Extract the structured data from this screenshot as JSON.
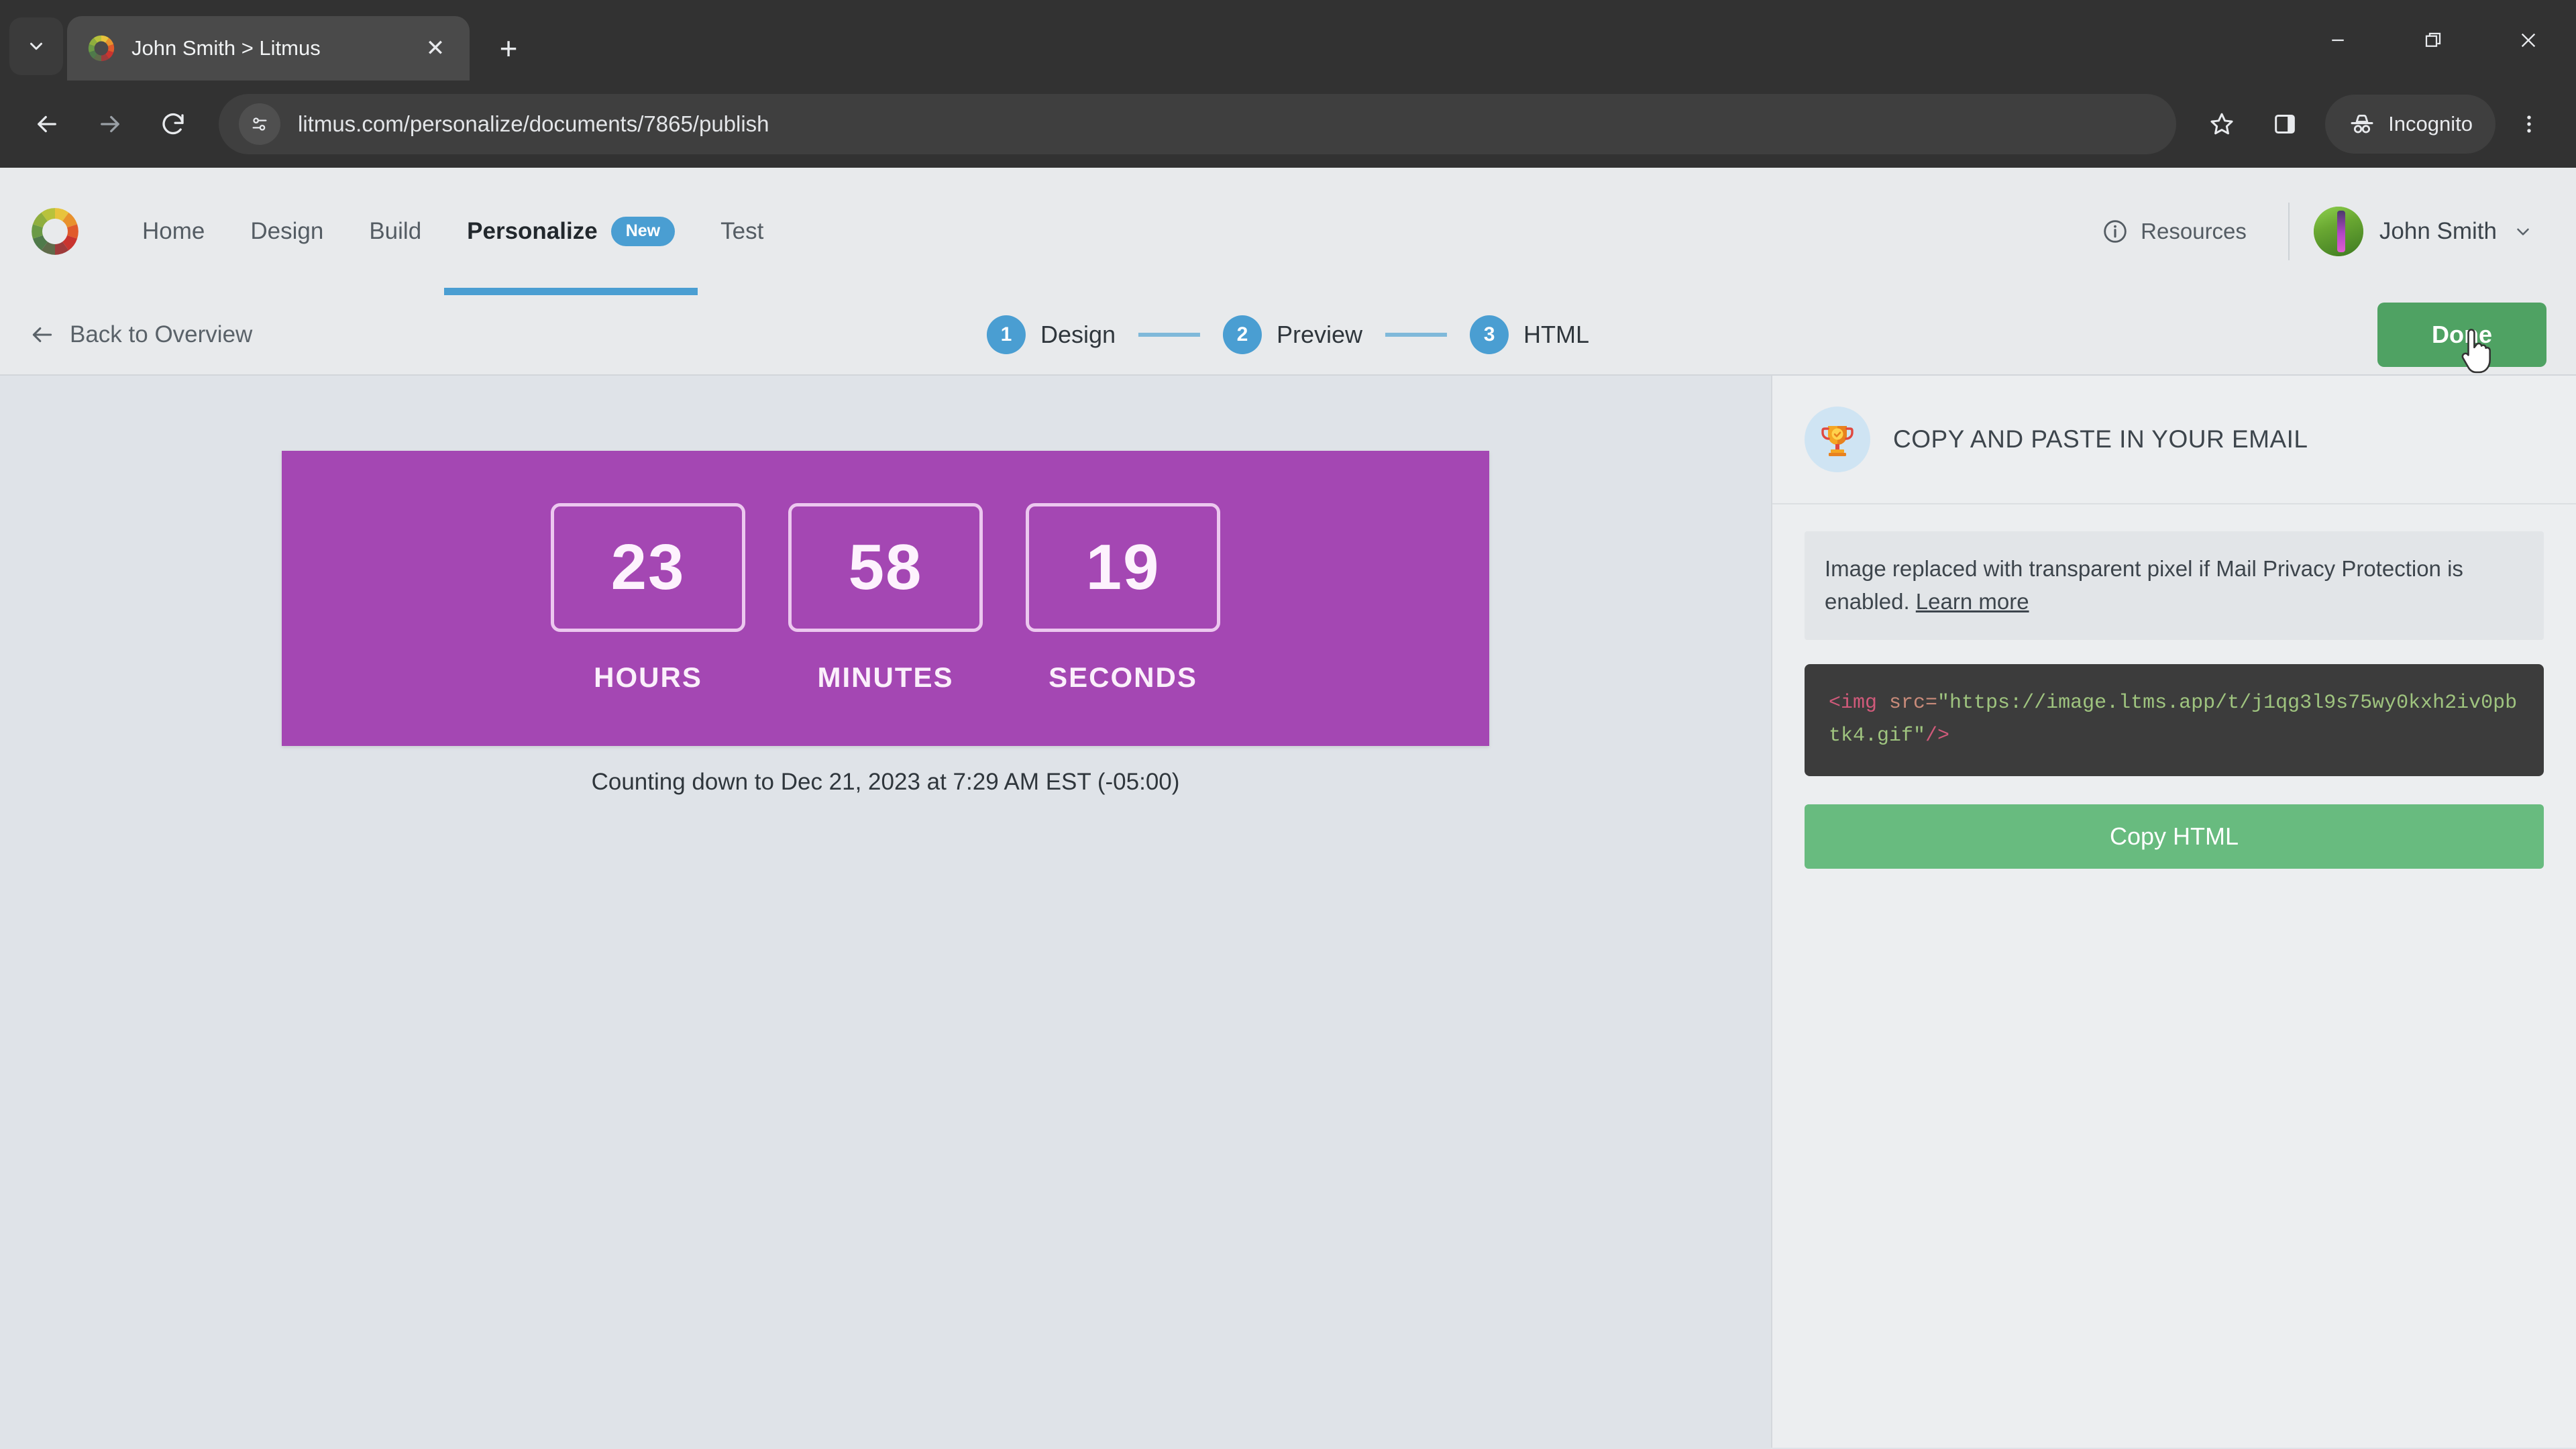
{
  "browser": {
    "tab": {
      "title": "John Smith > Litmus",
      "favicon": "litmus-color-wheel-icon",
      "close_label": "✕"
    },
    "tab_list_icon": "chevron-down-icon",
    "new_tab_label": "+",
    "window_controls": {
      "minimize": "minimize-icon",
      "restore": "restore-icon",
      "close": "close-icon"
    },
    "toolbar": {
      "back": "back-arrow-icon",
      "forward": "forward-arrow-icon",
      "reload": "reload-icon",
      "site_info": "site-settings-icon",
      "url": "litmus.com/personalize/documents/7865/publish",
      "bookmark": "star-icon",
      "side_panel": "side-panel-icon",
      "incognito_label": "Incognito",
      "incognito_icon": "incognito-hat-icon",
      "menu": "three-dot-menu-icon"
    }
  },
  "app_header": {
    "logo": "litmus-logo-icon",
    "nav": [
      {
        "label": "Home",
        "active": false
      },
      {
        "label": "Design",
        "active": false
      },
      {
        "label": "Build",
        "active": false
      },
      {
        "label": "Personalize",
        "active": true,
        "badge": "New"
      },
      {
        "label": "Test",
        "active": false
      }
    ],
    "resources_label": "Resources",
    "resources_icon": "info-circle-icon",
    "user_name": "John Smith",
    "user_chevron": "chevron-down-icon",
    "avatar": "user-avatar"
  },
  "wizard": {
    "back_label": "Back to Overview",
    "back_icon": "arrow-left-icon",
    "steps": [
      {
        "number": "1",
        "label": "Design"
      },
      {
        "number": "2",
        "label": "Preview"
      },
      {
        "number": "3",
        "label": "HTML"
      }
    ],
    "done_label": "Done"
  },
  "countdown": {
    "units": [
      {
        "value": "23",
        "label": "HOURS"
      },
      {
        "value": "58",
        "label": "MINUTES"
      },
      {
        "value": "19",
        "label": "SECONDS"
      }
    ],
    "caption": "Counting down to Dec 21, 2023 at 7:29 AM EST (-05:00)",
    "background_color": "#a447b3"
  },
  "side_panel": {
    "title": "COPY AND PASTE IN YOUR EMAIL",
    "icon": "trophy-icon",
    "notice_text": "Image replaced with transparent pixel if Mail Privacy Protection is enabled.",
    "notice_link": "Learn more",
    "code": {
      "tag_open": "<img",
      "attr": "src=",
      "value": "\"https://image.ltms.app/t/j1qg3l9s75wy0kxh2iv0pbtk4.gif\"",
      "tag_close": "/>"
    },
    "copy_label": "Copy HTML"
  },
  "colors": {
    "accent_blue": "#4a9ed2",
    "green": "#4fa263",
    "copy_green": "#68bb7f",
    "purple": "#a447b3",
    "chrome_dark": "#323232"
  }
}
